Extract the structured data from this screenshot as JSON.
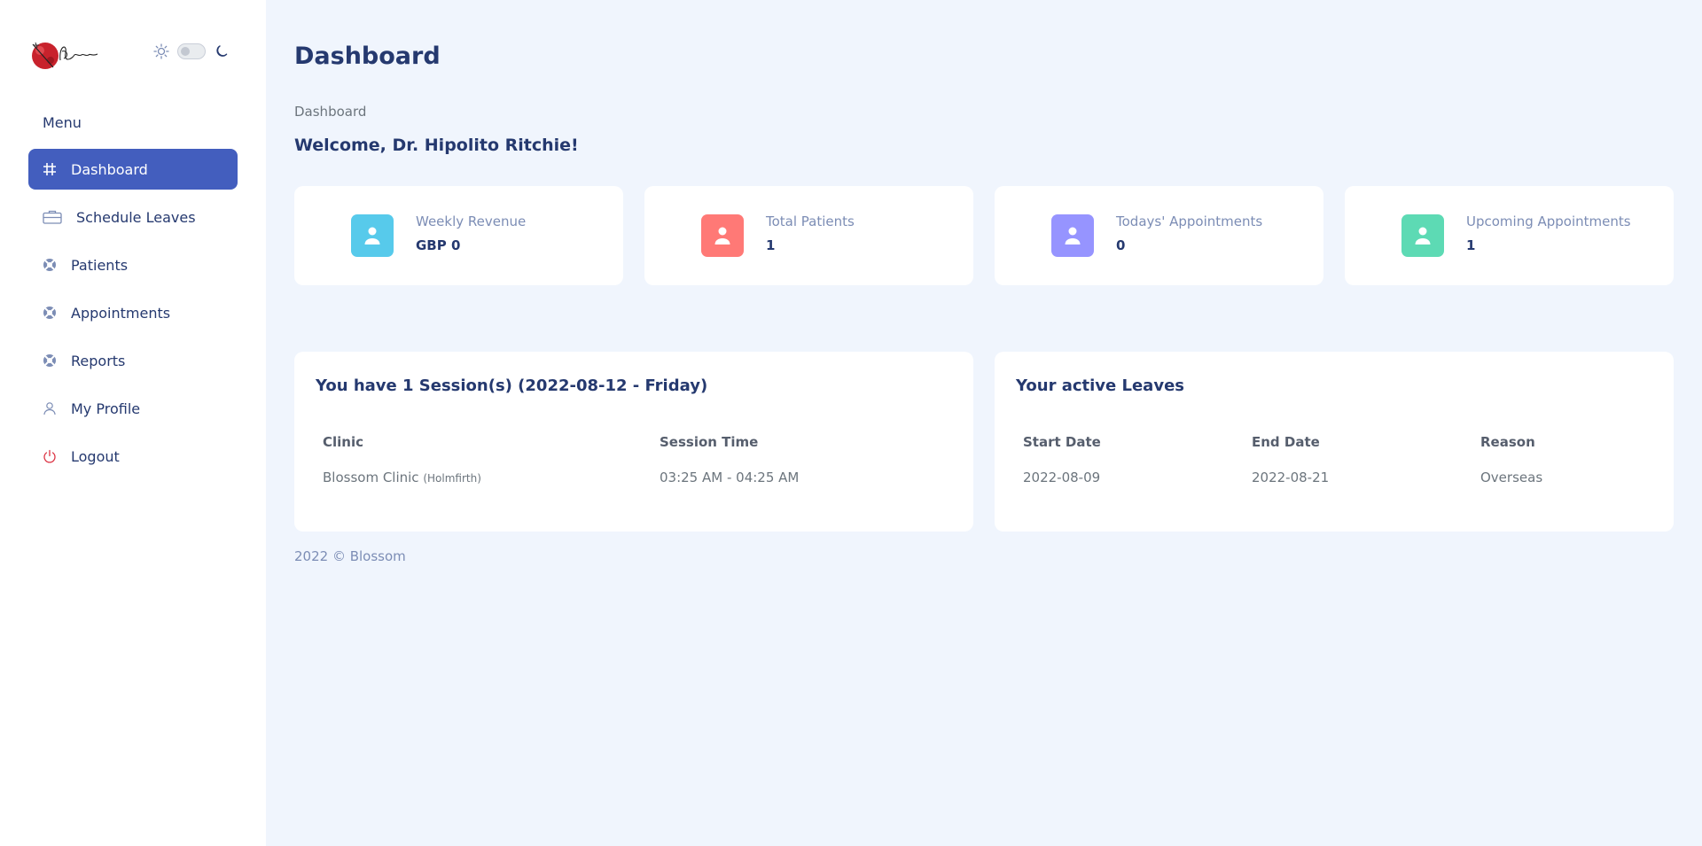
{
  "brand": {
    "logo_text": "Blossom"
  },
  "sidebar": {
    "menu_title": "Menu",
    "items": [
      {
        "label": "Dashboard",
        "icon": "grid-icon"
      },
      {
        "label": "Schedule Leaves",
        "icon": "briefcase-icon"
      },
      {
        "label": "Patients",
        "icon": "lifebuoy-icon"
      },
      {
        "label": "Appointments",
        "icon": "lifebuoy-icon"
      },
      {
        "label": "Reports",
        "icon": "lifebuoy-icon"
      },
      {
        "label": "My Profile",
        "icon": "person-icon"
      },
      {
        "label": "Logout",
        "icon": "power-icon"
      }
    ]
  },
  "header": {
    "title": "Dashboard",
    "breadcrumb": "Dashboard",
    "welcome": "Welcome, Dr. Hipolito Ritchie!"
  },
  "stats": [
    {
      "label": "Weekly Revenue",
      "value": "GBP 0",
      "color": "#57caeb"
    },
    {
      "label": "Total Patients",
      "value": "1",
      "color": "#ff7976"
    },
    {
      "label": "Todays' Appointments",
      "value": "0",
      "color": "#9694ff"
    },
    {
      "label": "Upcoming Appointments",
      "value": "1",
      "color": "#5ddab4"
    }
  ],
  "sessions": {
    "title": "You have 1 Session(s) (2022-08-12 - Friday)",
    "columns": [
      "Clinic",
      "Session Time"
    ],
    "row": {
      "clinic": "Blossom Clinic",
      "clinic_location": "(Holmfirth)",
      "time": "03:25 AM - 04:25 AM"
    }
  },
  "leaves": {
    "title": "Your active Leaves",
    "columns": [
      "Start Date",
      "End Date",
      "Reason"
    ],
    "row": {
      "start": "2022-08-09",
      "end": "2022-08-21",
      "reason": "Overseas"
    }
  },
  "footer": {
    "text": "2022 © Blossom"
  },
  "colors": {
    "accent": "#435ebe",
    "logout_icon": "#dc3545"
  }
}
